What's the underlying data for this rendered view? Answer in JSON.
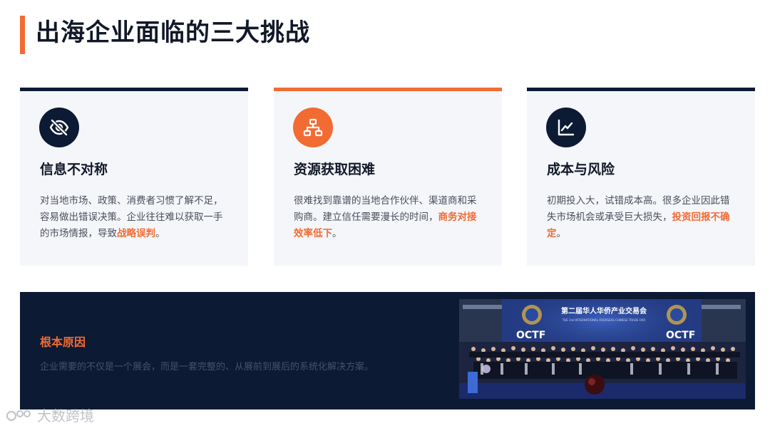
{
  "page": {
    "title": "出海企业面临的三大挑战",
    "accent": "#f26b33",
    "dark": "#0d1a33"
  },
  "cards": [
    {
      "icon": "eye-slash-icon",
      "title": "信息不对称",
      "text": "对当地市场、政策、消费者习惯了解不足，容易做出错误决策。企业往往难以获取一手的市场情报，导致",
      "highlight": "战略误判",
      "tail": "。"
    },
    {
      "icon": "network-icon",
      "title": "资源获取困难",
      "text": "很难找到靠谱的当地合作伙伴、渠道商和采购商。建立信任需要漫长的时间，",
      "highlight": "商务对接效率低下",
      "tail": "。"
    },
    {
      "icon": "line-chart-icon",
      "title": "成本与风险",
      "text": "初期投入大，试错成本高。很多企业因此错失市场机会或承受巨大损失，",
      "highlight": "投资回报不确定",
      "tail": "。"
    }
  ],
  "root_cause": {
    "title": "根本原因",
    "text": "企业需要的不仅是一个展会，而是一套完整的、从展前到展后的系统化解决方案。"
  },
  "photo": {
    "banner_title": "第二届华人华侨产业交易会",
    "banner_subtitle": "THE 2nd INTERNATIONAL OVERSEAS CHINESE TRADE FAIR",
    "logo_text": "OCTF"
  },
  "watermark": {
    "text": "大数跨境"
  }
}
